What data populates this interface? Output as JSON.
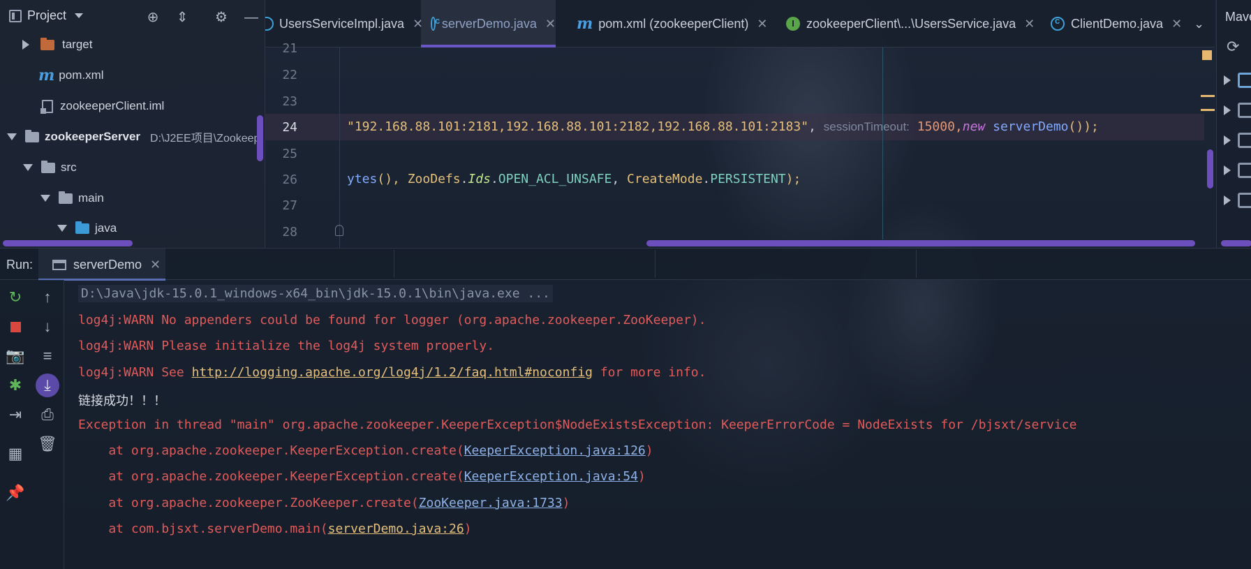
{
  "project_panel": {
    "title": "Project",
    "tree": [
      {
        "label": "target",
        "detail": ""
      },
      {
        "label": "pom.xml",
        "detail": ""
      },
      {
        "label": "zookeeperClient.iml",
        "detail": ""
      },
      {
        "label": "zookeeperServer",
        "detail": "D:\\J2EE项目\\Zookeep"
      },
      {
        "label": "src",
        "detail": ""
      },
      {
        "label": "main",
        "detail": ""
      },
      {
        "label": "java",
        "detail": ""
      }
    ]
  },
  "editor_tabs": [
    {
      "label": "UsersServiceImpl.java",
      "icon": "class-icon"
    },
    {
      "label": "serverDemo.java",
      "icon": "class-icon",
      "active": true
    },
    {
      "label": "pom.xml (zookeeperClient)",
      "icon": "maven-m-icon"
    },
    {
      "label": "zookeeperClient\\...\\UsersService.java",
      "icon": "interface-icon"
    },
    {
      "label": "ClientDemo.java",
      "icon": "class-icon"
    }
  ],
  "editor": {
    "line_numbers": [
      "21",
      "22",
      "23",
      "24",
      "25",
      "26",
      "27",
      "28"
    ],
    "current_line": "24",
    "line24": {
      "str": "\"192.168.88.101:2181,192.168.88.101:2182,192.168.88.101:2183\"",
      "comma1": ",",
      "hint": "sessionTimeout:",
      "num": "15000",
      "comma2": ",",
      "kw": "new",
      "cls": "serverDemo",
      "paren": "());"
    },
    "line26": {
      "t1": "ytes",
      "t2": "(), ",
      "t3": "ZooDefs",
      "t4": ".",
      "t5": "Ids",
      "t6": ".",
      "t7": "OPEN_ACL_UNSAFE",
      "t8": ", ",
      "t9": "CreateMode",
      "t10": ".",
      "t11": "PERSISTENT",
      "t12": ");"
    }
  },
  "maven_panel": {
    "title": "Mave"
  },
  "run_panel": {
    "label": "Run:",
    "tab": "serverDemo",
    "console": {
      "cmd": "D:\\Java\\jdk-15.0.1_windows-x64_bin\\jdk-15.0.1\\bin\\java.exe ...",
      "warn1": "log4j:WARN No appenders could be found for logger (org.apache.zookeeper.ZooKeeper).",
      "warn2": "log4j:WARN Please initialize the log4j system properly.",
      "warn3_pre": "log4j:WARN See ",
      "warn3_link": "http://logging.apache.org/log4j/1.2/faq.html#noconfig",
      "warn3_post": " for more info.",
      "success": "链接成功！！！",
      "exception": "Exception in thread \"main\" org.apache.zookeeper.KeeperException$NodeExistsException: KeeperErrorCode = NodeExists for /bjsxt/service",
      "stack": [
        {
          "pre": "    at org.apache.zookeeper.KeeperException.create(",
          "link": "KeeperException.java:126",
          "post": ")"
        },
        {
          "pre": "    at org.apache.zookeeper.KeeperException.create(",
          "link": "KeeperException.java:54",
          "post": ")"
        },
        {
          "pre": "    at org.apache.zookeeper.ZooKeeper.create(",
          "link": "ZooKeeper.java:1733",
          "post": ")"
        },
        {
          "pre": "    at com.bjsxt.serverDemo.main(",
          "link": "serverDemo.java:26",
          "post": ")"
        }
      ]
    }
  },
  "colors": {
    "accent_purple": "#6b56c7",
    "error_red": "#e25b5b",
    "string_yellow": "#e6c07b",
    "link_blue": "#8fb3e8"
  }
}
